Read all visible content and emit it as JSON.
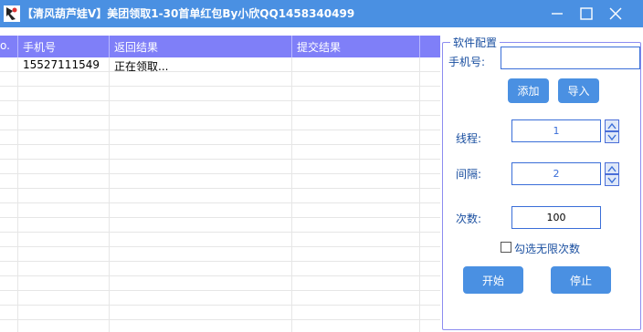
{
  "window": {
    "title": "【清风葫芦娃V】美团领取1-30首单红包By小欣QQ1458340499"
  },
  "list": {
    "columns": [
      {
        "label": "o."
      },
      {
        "label": "手机号"
      },
      {
        "label": "返回结果"
      },
      {
        "label": "提交结果"
      }
    ],
    "rows": [
      {
        "phone": "15527111549",
        "result": "正在领取..."
      }
    ]
  },
  "panel": {
    "group_title": "软件配置",
    "phone_label": "手机号:",
    "phone_value": "",
    "add_label": "添加",
    "import_label": "导入",
    "threads_label": "线程:",
    "threads_value": "1",
    "interval_label": "间隔:",
    "interval_value": "2",
    "count_label": "次数:",
    "count_value": "100",
    "unlimited_label": "勾选无限次数",
    "start_label": "开始",
    "stop_label": "停止"
  },
  "colors": {
    "titlebar": "#4a90e2",
    "header": "#7f7ff8",
    "button": "#4a90e2",
    "label": "#1a4fa0"
  },
  "icons": [
    "app-icon",
    "minimize-icon",
    "maximize-icon",
    "close-icon",
    "spin-up-icon",
    "spin-down-icon"
  ]
}
